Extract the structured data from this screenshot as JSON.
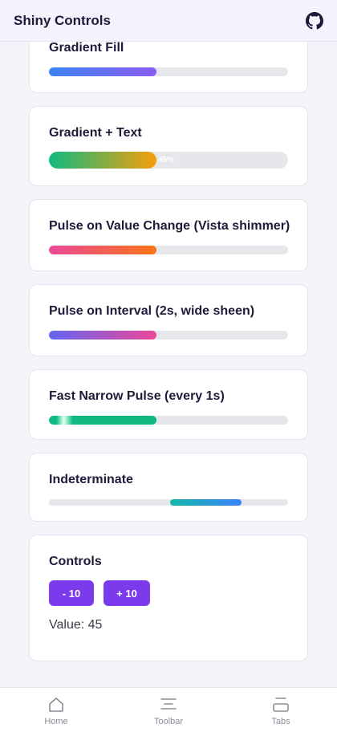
{
  "header": {
    "title": "Shiny Controls",
    "github_icon": "github-icon"
  },
  "cards": {
    "gradient_fill": {
      "title": "Gradient Fill",
      "progress": 0.45
    },
    "gradient_text": {
      "title": "Gradient + Text",
      "progress": 0.45,
      "label": "45%"
    },
    "pulse_value": {
      "title": "Pulse on Value Change (Vista shimmer)",
      "progress": 0.45
    },
    "pulse_interval": {
      "title": "Pulse on Interval (2s, wide sheen)",
      "progress": 0.45
    },
    "fast_pulse": {
      "title": "Fast Narrow Pulse (every 1s)",
      "progress": 0.45
    },
    "indeterminate": {
      "title": "Indeterminate"
    }
  },
  "controls": {
    "title": "Controls",
    "minus_label": "- 10",
    "plus_label": "+ 10",
    "value_prefix": "Value:",
    "value": "45"
  },
  "nav": {
    "items": [
      {
        "label": "Home",
        "icon": "home-icon"
      },
      {
        "label": "Toolbar",
        "icon": "toolbar-icon"
      },
      {
        "label": "Tabs",
        "icon": "tabs-icon"
      }
    ]
  },
  "colors": {
    "accent": "#7c3aed",
    "track": "#e5e7eb",
    "header_bg": "#f3f2fd",
    "page_bg": "#f3f5fb"
  }
}
